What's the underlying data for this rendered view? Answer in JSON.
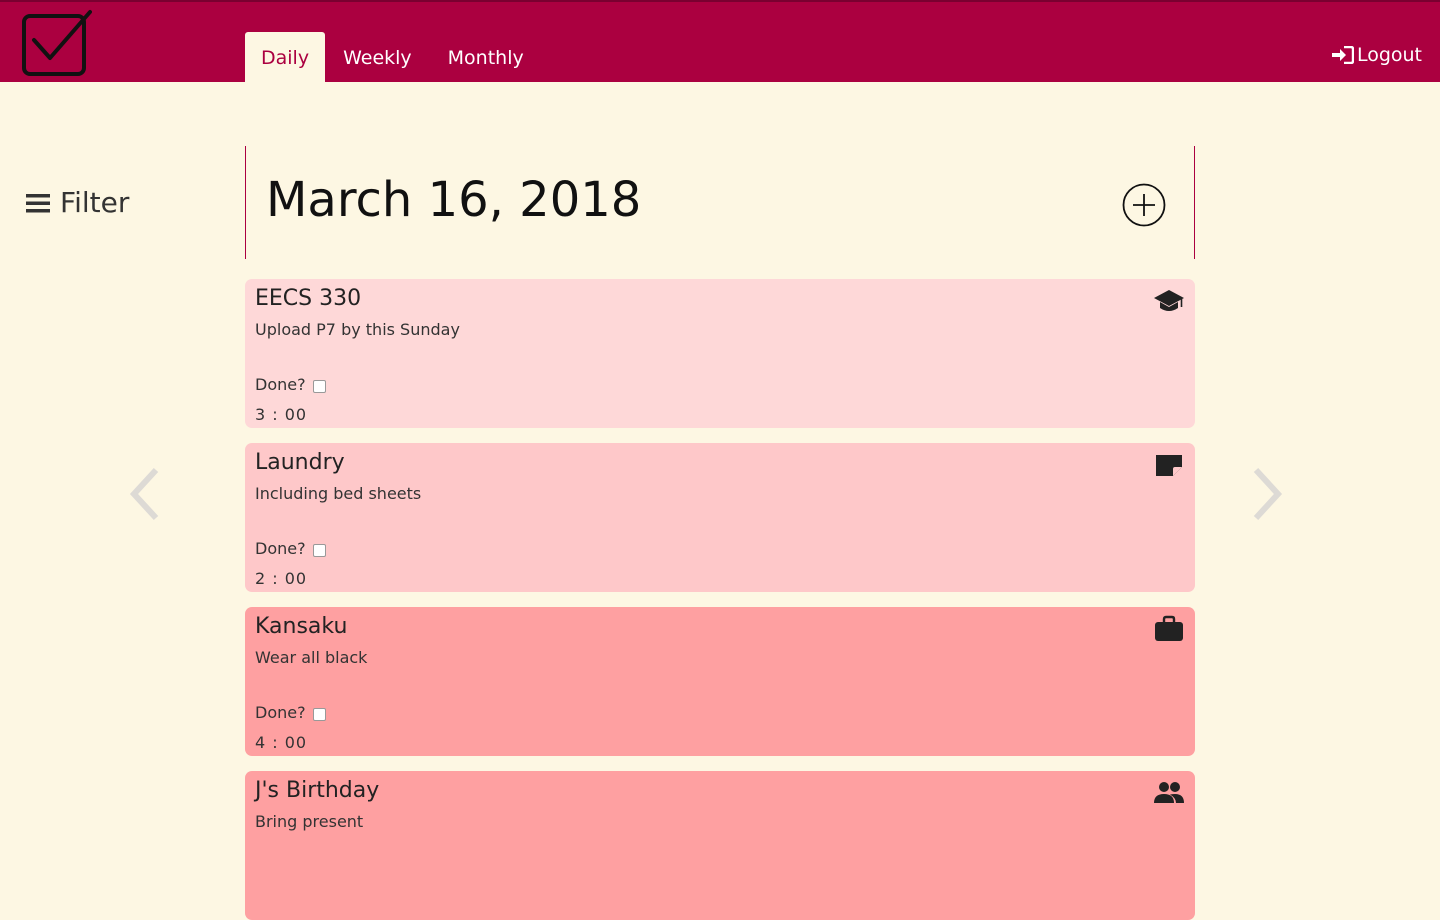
{
  "nav": {
    "tabs": [
      {
        "label": "Daily",
        "active": true
      },
      {
        "label": "Weekly",
        "active": false
      },
      {
        "label": "Monthly",
        "active": false
      }
    ],
    "logout_label": "Logout"
  },
  "sidebar": {
    "filter_label": "Filter"
  },
  "main": {
    "date_title": "March 16, 2018"
  },
  "tasks": [
    {
      "title": "EECS 330",
      "description": "Upload P7 by this Sunday",
      "done_label": "Done?",
      "done": false,
      "time": "3 : 00",
      "icon": "graduation-cap-icon",
      "color": "#fed8d8"
    },
    {
      "title": "Laundry",
      "description": "Including bed sheets",
      "done_label": "Done?",
      "done": false,
      "time": "2 : 00",
      "icon": "note-icon",
      "color": "#fec8c9"
    },
    {
      "title": "Kansaku",
      "description": "Wear all black",
      "done_label": "Done?",
      "done": false,
      "time": "4 : 00",
      "icon": "briefcase-icon",
      "color": "#fea0a1"
    },
    {
      "title": "J's Birthday",
      "description": "Bring present",
      "icon": "people-icon",
      "color": "#fea0a1"
    }
  ],
  "colors": {
    "brand": "#ab0040",
    "background": "#fdf7e3"
  }
}
